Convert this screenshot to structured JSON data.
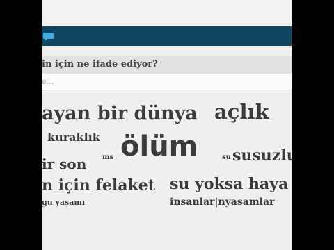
{
  "question": {
    "text": "in için ne ifade ediyor?"
  },
  "answer": {
    "placeholder": "e..."
  },
  "word_cloud": [
    {
      "id": "hayan-bir-dunya",
      "text": "ayan bir dünya"
    },
    {
      "id": "aclik",
      "text": "açlık"
    },
    {
      "id": "kuraklik",
      "text": "kuraklık"
    },
    {
      "id": "olum",
      "text": "ölüm"
    },
    {
      "id": "ms",
      "text": "ms"
    },
    {
      "id": "su-small",
      "text": "su"
    },
    {
      "id": "susuzluk",
      "text": "susuzlu"
    },
    {
      "id": "bir-son",
      "text": "ir son"
    },
    {
      "id": "icin-felaket",
      "text": "n için felaket"
    },
    {
      "id": "su-yoksa-hayat",
      "text": "su yoksa haya"
    },
    {
      "id": "insanlar-yasamlar",
      "text": "insanlar|nyasamlar"
    },
    {
      "id": "gu-yasami",
      "text": "gu yaşamı"
    }
  ],
  "watermark": {
    "text": ""
  }
}
